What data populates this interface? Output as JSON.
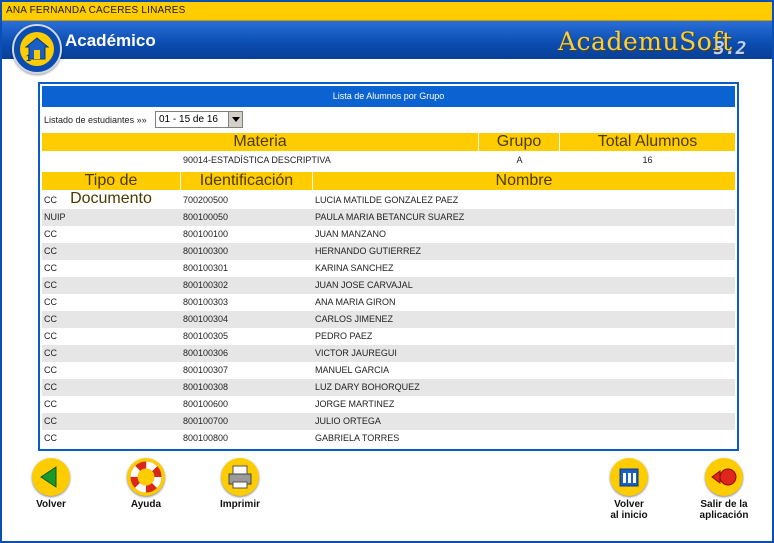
{
  "user": {
    "name": "ANA FERNANDA CACERES LINARES"
  },
  "header": {
    "title": "Académico",
    "brand": "AcademuSoft",
    "version": "3.2"
  },
  "panel": {
    "title": "Lista de Alumnos por Grupo",
    "listado_label": "Listado de estudiantes »»",
    "range": "01 - 15 de 16"
  },
  "materia_table": {
    "headers": {
      "materia": "Materia",
      "grupo": "Grupo",
      "total": "Total Alumnos"
    },
    "row": {
      "materia": "90014-ESTADÍSTICA DESCRIPTIVA",
      "grupo": "A",
      "total": "16"
    }
  },
  "students": {
    "headers": {
      "tipo": "Tipo de Documento",
      "id": "Identificación",
      "nombre": "Nombre"
    },
    "rows": [
      {
        "tipo": "CC",
        "id": "700200500",
        "nombre": "LUCIA MATILDE GONZALEZ PAEZ"
      },
      {
        "tipo": "NUIP",
        "id": "800100050",
        "nombre": "PAULA MARIA BETANCUR SUAREZ"
      },
      {
        "tipo": "CC",
        "id": "800100100",
        "nombre": "JUAN MANZANO"
      },
      {
        "tipo": "CC",
        "id": "800100300",
        "nombre": "HERNANDO GUTIERREZ"
      },
      {
        "tipo": "CC",
        "id": "800100301",
        "nombre": "KARINA SANCHEZ"
      },
      {
        "tipo": "CC",
        "id": "800100302",
        "nombre": "JUAN JOSE CARVAJAL"
      },
      {
        "tipo": "CC",
        "id": "800100303",
        "nombre": "ANA MARIA GIRON"
      },
      {
        "tipo": "CC",
        "id": "800100304",
        "nombre": "CARLOS JIMENEZ"
      },
      {
        "tipo": "CC",
        "id": "800100305",
        "nombre": "PEDRO PAEZ"
      },
      {
        "tipo": "CC",
        "id": "800100306",
        "nombre": "VICTOR JAUREGUI"
      },
      {
        "tipo": "CC",
        "id": "800100307",
        "nombre": "MANUEL GARCIA"
      },
      {
        "tipo": "CC",
        "id": "800100308",
        "nombre": "LUZ DARY BOHORQUEZ"
      },
      {
        "tipo": "CC",
        "id": "800100600",
        "nombre": "JORGE MARTINEZ"
      },
      {
        "tipo": "CC",
        "id": "800100700",
        "nombre": "JULIO ORTEGA"
      },
      {
        "tipo": "CC",
        "id": "800100800",
        "nombre": "GABRIELA TORRES"
      }
    ]
  },
  "buttons": {
    "volver": "Volver",
    "ayuda": "Ayuda",
    "imprimir": "Imprimir",
    "volver_inicio_1": "Volver",
    "volver_inicio_2": "al inicio",
    "salir_1": "Salir de la",
    "salir_2": "aplicación"
  },
  "colors": {
    "accent": "#ffcc00",
    "brand_blue": "#0a4cb0",
    "row_alt": "#e6e6e6"
  }
}
